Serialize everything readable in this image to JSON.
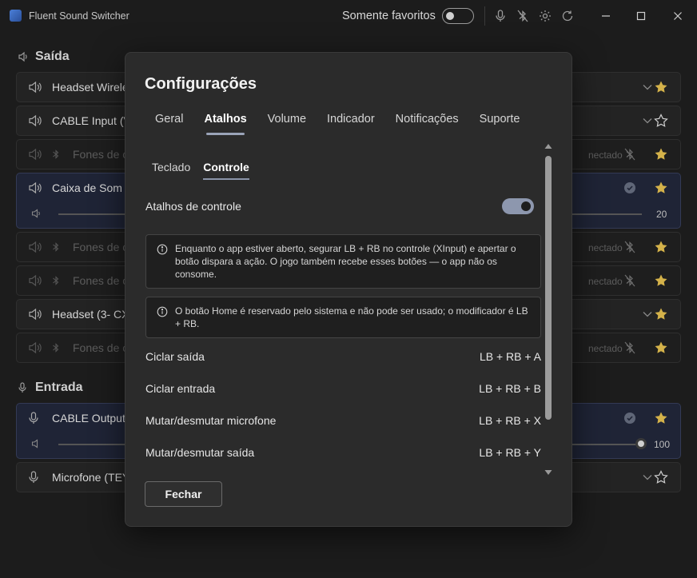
{
  "app": {
    "title": "Fluent Sound Switcher",
    "icon": "app-logo-icon"
  },
  "titlebar": {
    "favorites_label": "Somente favoritos",
    "favorites_on": false,
    "icons": [
      "microphone-icon",
      "bluetooth-off-icon",
      "gear-icon",
      "refresh-icon"
    ],
    "window_buttons": [
      "minimize-icon",
      "maximize-icon",
      "close-icon"
    ]
  },
  "output": {
    "heading": "Saída",
    "devices": [
      {
        "name": "Headset Wirele",
        "state": "normal",
        "favorite": true,
        "right_icon": "chevron-down-icon"
      },
      {
        "name": "CABLE Input (V",
        "state": "normal",
        "favorite": false,
        "right_icon": "chevron-down-icon"
      },
      {
        "name": "Fones de o",
        "state": "disconnected",
        "status": "nectado",
        "favorite": true,
        "right_icon": "bluetooth-off-icon"
      },
      {
        "name": "Caixa de Som (",
        "state": "active",
        "favorite": true,
        "right_icon": "check-circle-icon",
        "volume": "20",
        "volume_level": 20
      },
      {
        "name": "Fones de o",
        "state": "disconnected",
        "status": "nectado",
        "favorite": true,
        "right_icon": "bluetooth-off-icon"
      },
      {
        "name": "Fones de o",
        "state": "disconnected",
        "status": "nectado",
        "favorite": true,
        "right_icon": "bluetooth-off-icon"
      },
      {
        "name": "Headset (3- CX",
        "state": "normal",
        "favorite": true,
        "right_icon": "chevron-down-icon"
      },
      {
        "name": "Fones de o",
        "state": "disconnected",
        "status": "nectado",
        "favorite": true,
        "right_icon": "bluetooth-off-icon"
      }
    ]
  },
  "input": {
    "heading": "Entrada",
    "devices": [
      {
        "name": "CABLE Output",
        "state": "active",
        "favorite": true,
        "right_icon": "check-circle-icon",
        "volume": "100",
        "volume_level": 100
      },
      {
        "name": "Microfone (TEY",
        "state": "normal",
        "favorite": false,
        "right_icon": "chevron-down-icon"
      }
    ]
  },
  "settings": {
    "title": "Configurações",
    "tabs": [
      "Geral",
      "Atalhos",
      "Volume",
      "Indicador",
      "Notificações",
      "Suporte"
    ],
    "active_tab": "Atalhos",
    "subtabs": [
      "Teclado",
      "Controle"
    ],
    "active_subtab": "Controle",
    "controller_shortcuts_label": "Atalhos de controle",
    "controller_shortcuts_on": true,
    "info": [
      "Enquanto o app estiver aberto, segurar LB + RB no controle (XInput) e apertar o botão dispara a ação. O jogo também recebe esses botões — o app não os consome.",
      "O botão Home é reservado pelo sistema e não pode ser usado; o modificador é LB + RB."
    ],
    "shortcuts": [
      {
        "label": "Ciclar saída",
        "keys": "LB + RB + A"
      },
      {
        "label": "Ciclar entrada",
        "keys": "LB + RB + B"
      },
      {
        "label": "Mutar/desmutar microfone",
        "keys": "LB + RB + X"
      },
      {
        "label": "Mutar/desmutar saída",
        "keys": "LB + RB + Y"
      }
    ],
    "close_label": "Fechar"
  },
  "colors": {
    "star_filled": "#d4b24a",
    "accent": "#8d97ae",
    "active_card": "#1f2436"
  }
}
